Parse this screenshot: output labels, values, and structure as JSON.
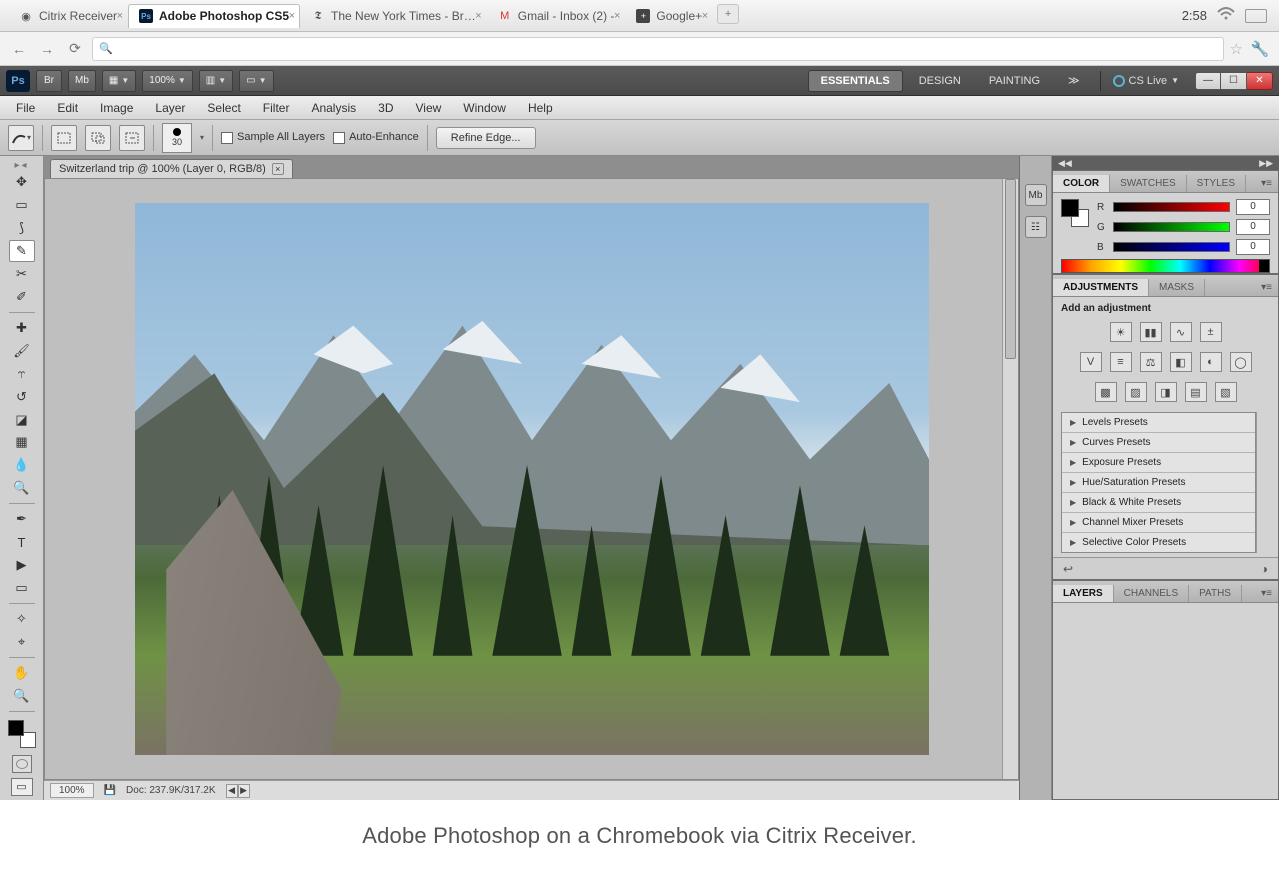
{
  "os": {
    "tabs": [
      {
        "label": "Citrix Receiver",
        "icon": "◎"
      },
      {
        "label": "Adobe Photoshop CS5",
        "icon": "Ps",
        "active": true
      },
      {
        "label": "The New York Times - Br…",
        "icon": "𝕿"
      },
      {
        "label": "Gmail - Inbox (2) -",
        "icon": "M"
      },
      {
        "label": "Google+",
        "icon": "▭"
      }
    ],
    "clock": "2:58"
  },
  "chrome": {
    "omnibox_placeholder": ""
  },
  "ps": {
    "topbar": {
      "zoom": "100%",
      "workspaces": [
        "ESSENTIALS",
        "DESIGN",
        "PAINTING"
      ],
      "active_workspace": "ESSENTIALS",
      "cs_live": "CS Live"
    },
    "menu": [
      "File",
      "Edit",
      "Image",
      "Layer",
      "Select",
      "Filter",
      "Analysis",
      "3D",
      "View",
      "Window",
      "Help"
    ],
    "options": {
      "brush_size": "30",
      "sample_all": "Sample All Layers",
      "auto_enhance": "Auto-Enhance",
      "refine": "Refine Edge..."
    },
    "doc_tab": "Switzerland trip @ 100% (Layer 0, RGB/8)",
    "status": {
      "zoom": "100%",
      "doc": "Doc: 237.9K/317.2K"
    },
    "panels": {
      "color": {
        "tabs": [
          "COLOR",
          "SWATCHES",
          "STYLES"
        ],
        "R": "0",
        "G": "0",
        "B": "0"
      },
      "adjust": {
        "tabs": [
          "ADJUSTMENTS",
          "MASKS"
        ],
        "hint": "Add an adjustment",
        "presets": [
          "Levels Presets",
          "Curves Presets",
          "Exposure Presets",
          "Hue/Saturation Presets",
          "Black & White Presets",
          "Channel Mixer Presets",
          "Selective Color Presets"
        ]
      },
      "layers": {
        "tabs": [
          "LAYERS",
          "CHANNELS",
          "PATHS"
        ]
      }
    }
  },
  "caption": "Adobe Photoshop on a Chromebook via Citrix Receiver."
}
